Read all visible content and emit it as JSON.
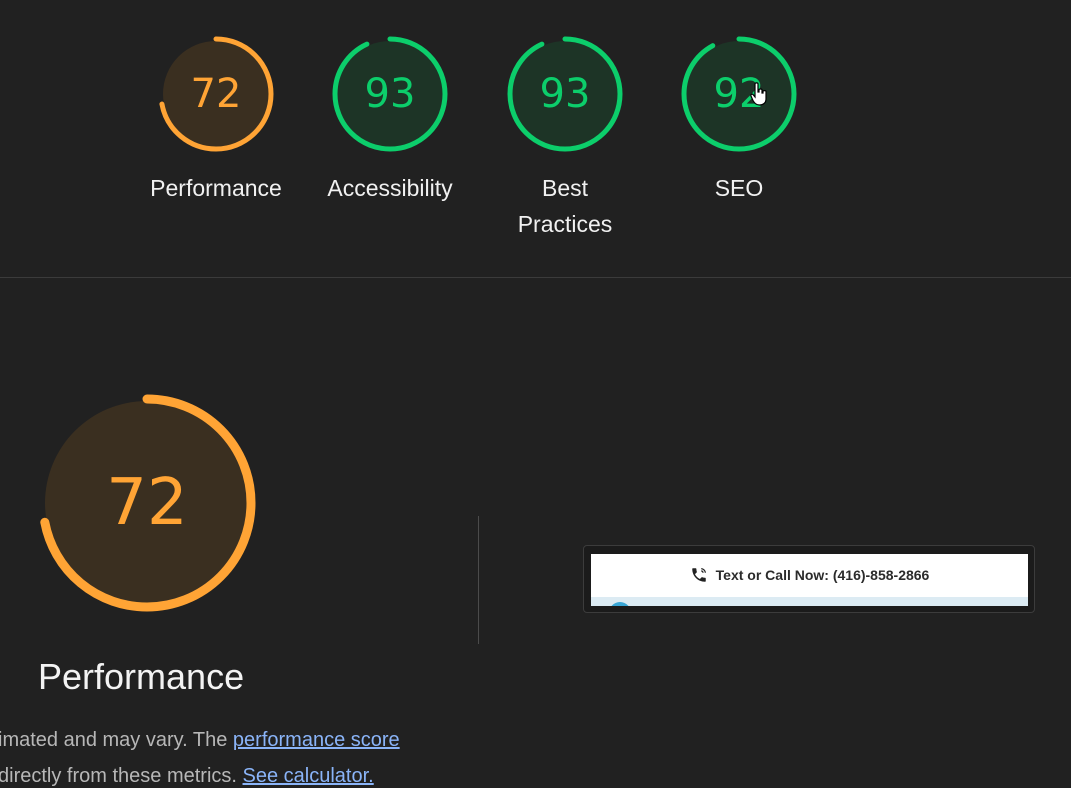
{
  "colors": {
    "background": "#212121",
    "average": "#ffa435",
    "average_fill": "#3a2f20",
    "pass": "#0cce6b",
    "pass_fill": "#1d3426",
    "link": "#8ab4f8"
  },
  "summary": {
    "categories": [
      {
        "label": "Performance",
        "score": "72",
        "rating": "average",
        "fraction": 0.72
      },
      {
        "label": "Accessibility",
        "score": "93",
        "rating": "pass",
        "fraction": 0.93
      },
      {
        "label": "Best\nPractices",
        "label_line1": "Best",
        "label_line2": "Practices",
        "score": "93",
        "rating": "pass",
        "fraction": 0.93
      },
      {
        "label": "SEO",
        "score": "92",
        "rating": "pass",
        "fraction": 0.92
      }
    ]
  },
  "performance": {
    "score": "72",
    "fraction": 0.72,
    "title": "Performance",
    "desc_line1_text": "imated and may vary. The ",
    "desc_line1_link": "performance score",
    "desc_line2_text": " directly from these metrics. ",
    "desc_line2_link": "See calculator."
  },
  "screenshot": {
    "phone_icon": "phone-icon",
    "banner_text": "Text or Call Now: (416)-858-2866"
  },
  "cursor_icon": "hand-pointer-icon"
}
